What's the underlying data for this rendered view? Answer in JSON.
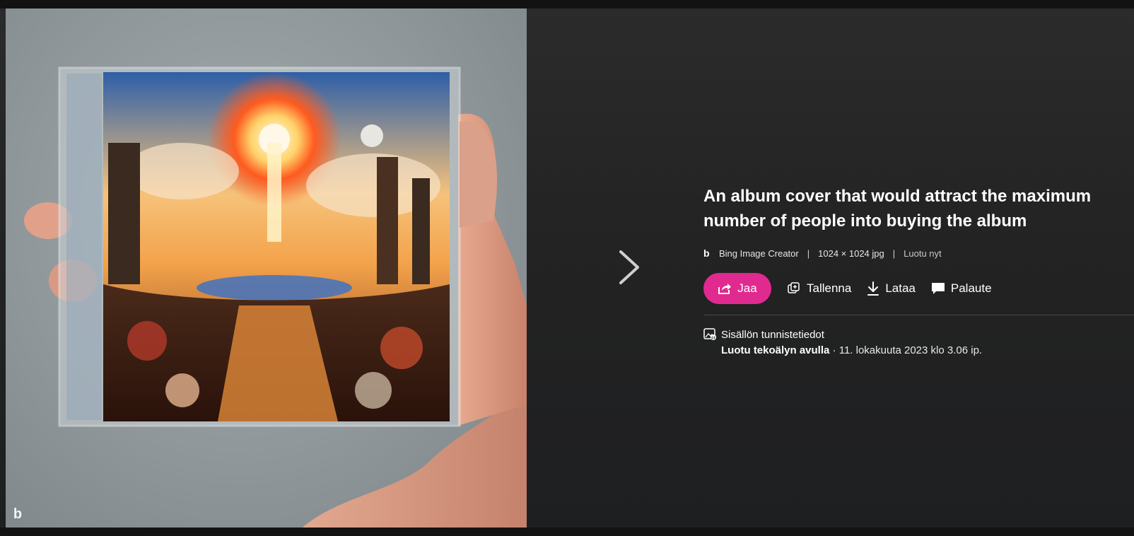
{
  "image": {
    "watermark_icon": "bing-b-icon"
  },
  "navigation": {
    "next_icon": "chevron-right-icon"
  },
  "info": {
    "title": "An album cover that would attract the maximum number of people into buying the album",
    "meta": {
      "logo_icon": "bing-logo-icon",
      "logo_glyph": "b",
      "source": "Bing Image Creator",
      "separator": "|",
      "dimensions": "1024 × 1024 jpg",
      "created": "Luotu nyt"
    },
    "actions": {
      "share_label": "Jaa",
      "save_label": "Tallenna",
      "download_label": "Lataa",
      "feedback_label": "Palaute"
    },
    "credentials": {
      "heading": "Sisällön tunnistetiedot",
      "ai_label": "Luotu tekoälyn avulla",
      "date": "· 11. lokakuuta 2023 klo 3.06 ip."
    }
  },
  "colors": {
    "accent": "#e02a8f",
    "background": "#1b1b1b",
    "text": "#ffffff"
  }
}
